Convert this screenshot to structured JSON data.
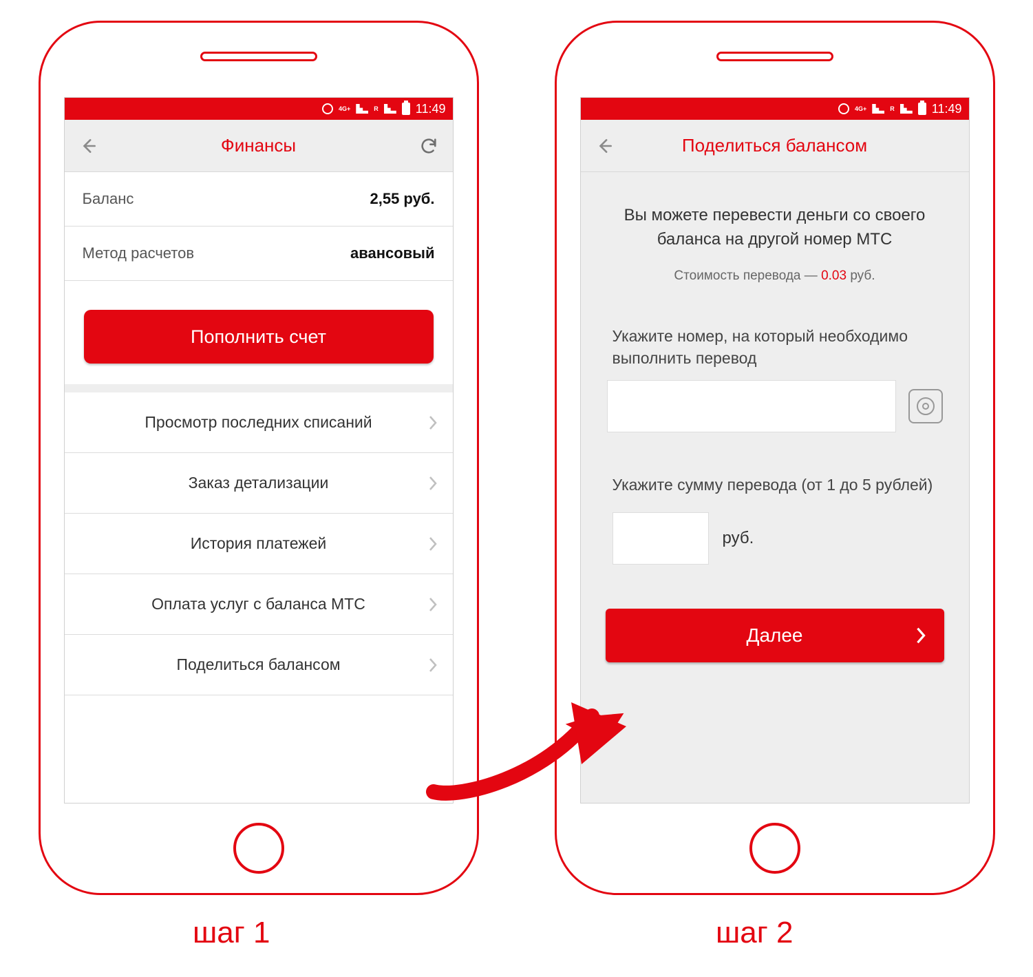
{
  "statusbar": {
    "time": "11:49",
    "net": "4G+",
    "roam": "R"
  },
  "screen1": {
    "title": "Финансы",
    "balance_label": "Баланс",
    "balance_value": "2,55 руб.",
    "method_label": "Метод расчетов",
    "method_value": "авансовый",
    "topup": "Пополнить счет",
    "items": [
      "Просмотр последних списаний",
      "Заказ детализации",
      "История платежей",
      "Оплата услуг с баланса МТС",
      "Поделиться балансом"
    ]
  },
  "screen2": {
    "title": "Поделиться балансом",
    "desc": "Вы можете перевести деньги со своего баланса на другой номер МТС",
    "cost_prefix": "Стоимость перевода — ",
    "cost_amount": "0.03",
    "cost_suffix": " руб.",
    "number_label": "Укажите номер, на который необходимо выполнить перевод",
    "amount_label": "Укажите сумму перевода (от 1 до 5 рублей)",
    "rub": "руб.",
    "next": "Далее"
  },
  "captions": {
    "step1": "шаг 1",
    "step2": "шаг 2"
  }
}
